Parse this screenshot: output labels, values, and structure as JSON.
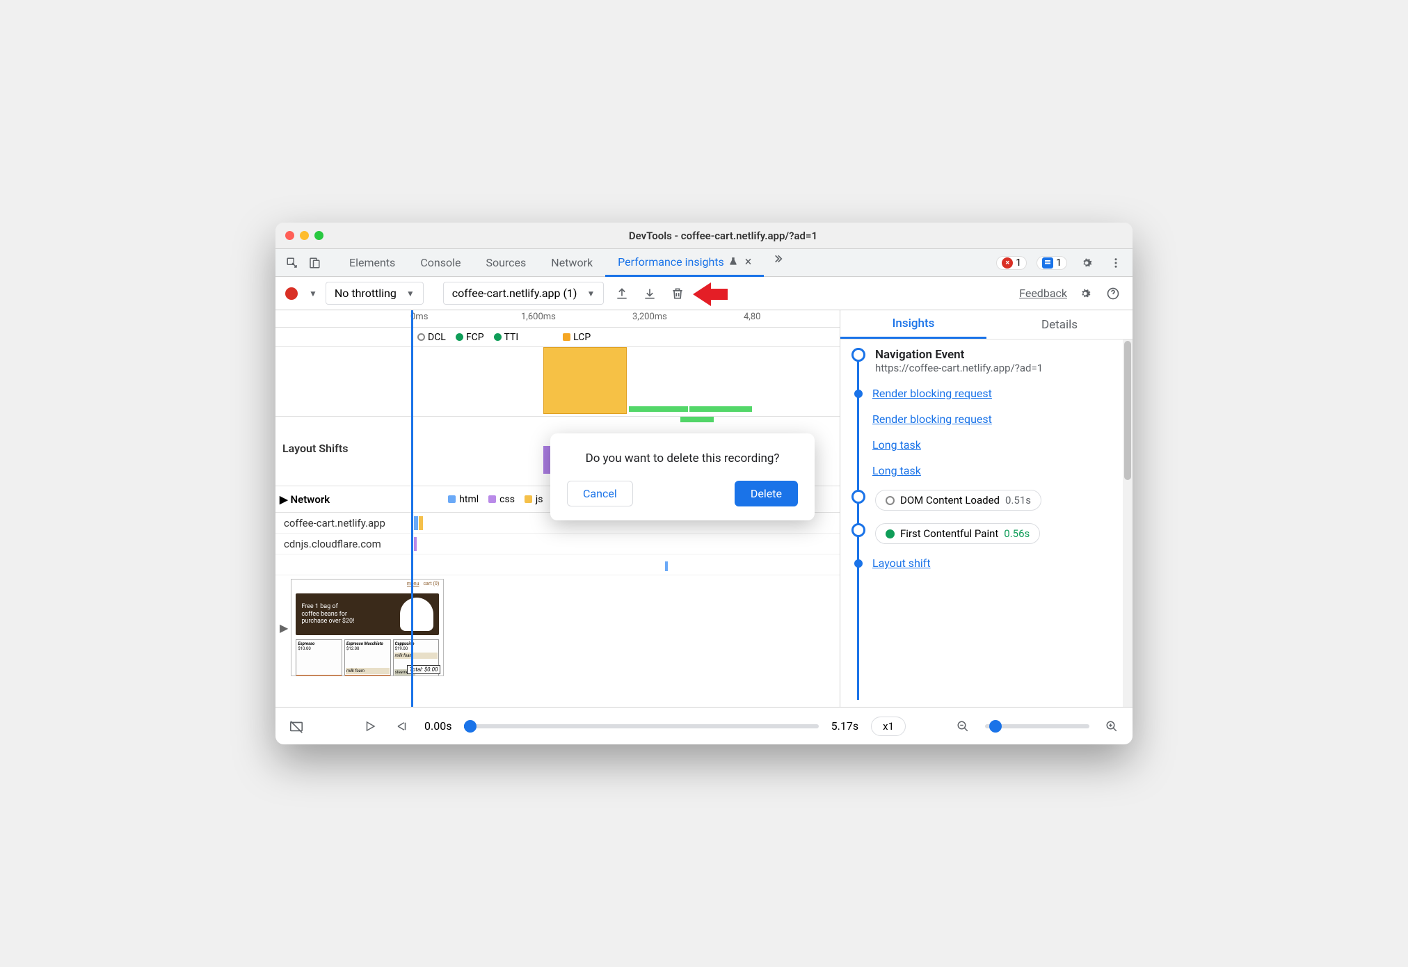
{
  "window": {
    "title": "DevTools - coffee-cart.netlify.app/?ad=1"
  },
  "tabs": {
    "items": [
      "Elements",
      "Console",
      "Sources",
      "Network",
      "Performance insights"
    ],
    "active_index": 4,
    "errors_count": "1",
    "info_count": "1"
  },
  "toolbar": {
    "throttling": "No throttling",
    "recording": "coffee-cart.netlify.app (1)",
    "feedback": "Feedback"
  },
  "timeline": {
    "marks": [
      "0ms",
      "1,600ms",
      "3,200ms",
      "4,80"
    ],
    "markers": [
      "DCL",
      "FCP",
      "TTI",
      "LCP"
    ],
    "layout_shifts_label": "Layout Shifts",
    "network_label": "Network",
    "net_legend": [
      "html",
      "css",
      "js"
    ],
    "net_hosts": [
      "coffee-cart.netlify.app",
      "cdnjs.cloudflare.com"
    ]
  },
  "thumb": {
    "banner": "Free 1 bag of coffee beans for purchase over $20!",
    "nav_menu": "menu",
    "nav_cart": "cart (0)",
    "p1": "Espresso",
    "p1p": "$10.00",
    "p2": "Espresso Macchiato",
    "p2p": "$12.00",
    "p3": "Cappucino",
    "p3p": "$19.00",
    "milk": "milk foam",
    "steamed": "steamed",
    "total": "Total: $0.00"
  },
  "right": {
    "tabs": [
      "Insights",
      "Details"
    ],
    "nav_title": "Navigation Event",
    "nav_url": "https://coffee-cart.netlify.app/?ad=1",
    "links": [
      "Render blocking request",
      "Render blocking request",
      "Long task",
      "Long task"
    ],
    "dcl_label": "DOM Content Loaded",
    "dcl_time": "0.51s",
    "fcp_label": "First Contentful Paint",
    "fcp_time": "0.56s",
    "layout_shift": "Layout shift"
  },
  "bottom": {
    "start": "0.00s",
    "end": "5.17s",
    "speed": "x1"
  },
  "dialog": {
    "message": "Do you want to delete this recording?",
    "cancel": "Cancel",
    "delete": "Delete"
  }
}
